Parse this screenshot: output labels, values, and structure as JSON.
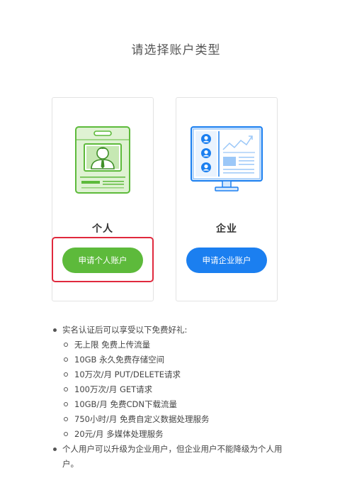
{
  "page": {
    "title": "请选择账户类型"
  },
  "cards": {
    "personal": {
      "title": "个人",
      "button_label": "申请个人账户",
      "icon": "id-badge-icon",
      "color": "#5dba3b"
    },
    "enterprise": {
      "title": "企业",
      "button_label": "申请企业账户",
      "icon": "monitor-dashboard-icon",
      "color": "#1b7ff0"
    }
  },
  "highlight": {
    "target": "personal-account-button",
    "color": "#e0293d"
  },
  "benefits": {
    "intro": "实名认证后可以享受以下免费好礼:",
    "items": [
      "无上限 免费上传流量",
      "10GB 永久免费存储空间",
      "10万次/月 PUT/DELETE请求",
      "100万次/月 GET请求",
      "10GB/月 免费CDN下载流量",
      "750小时/月 免费自定义数据处理服务",
      "20元/月 多媒体处理服务"
    ],
    "note": "个人用户可以升级为企业用户，但企业用户不能降级为个人用户。"
  }
}
